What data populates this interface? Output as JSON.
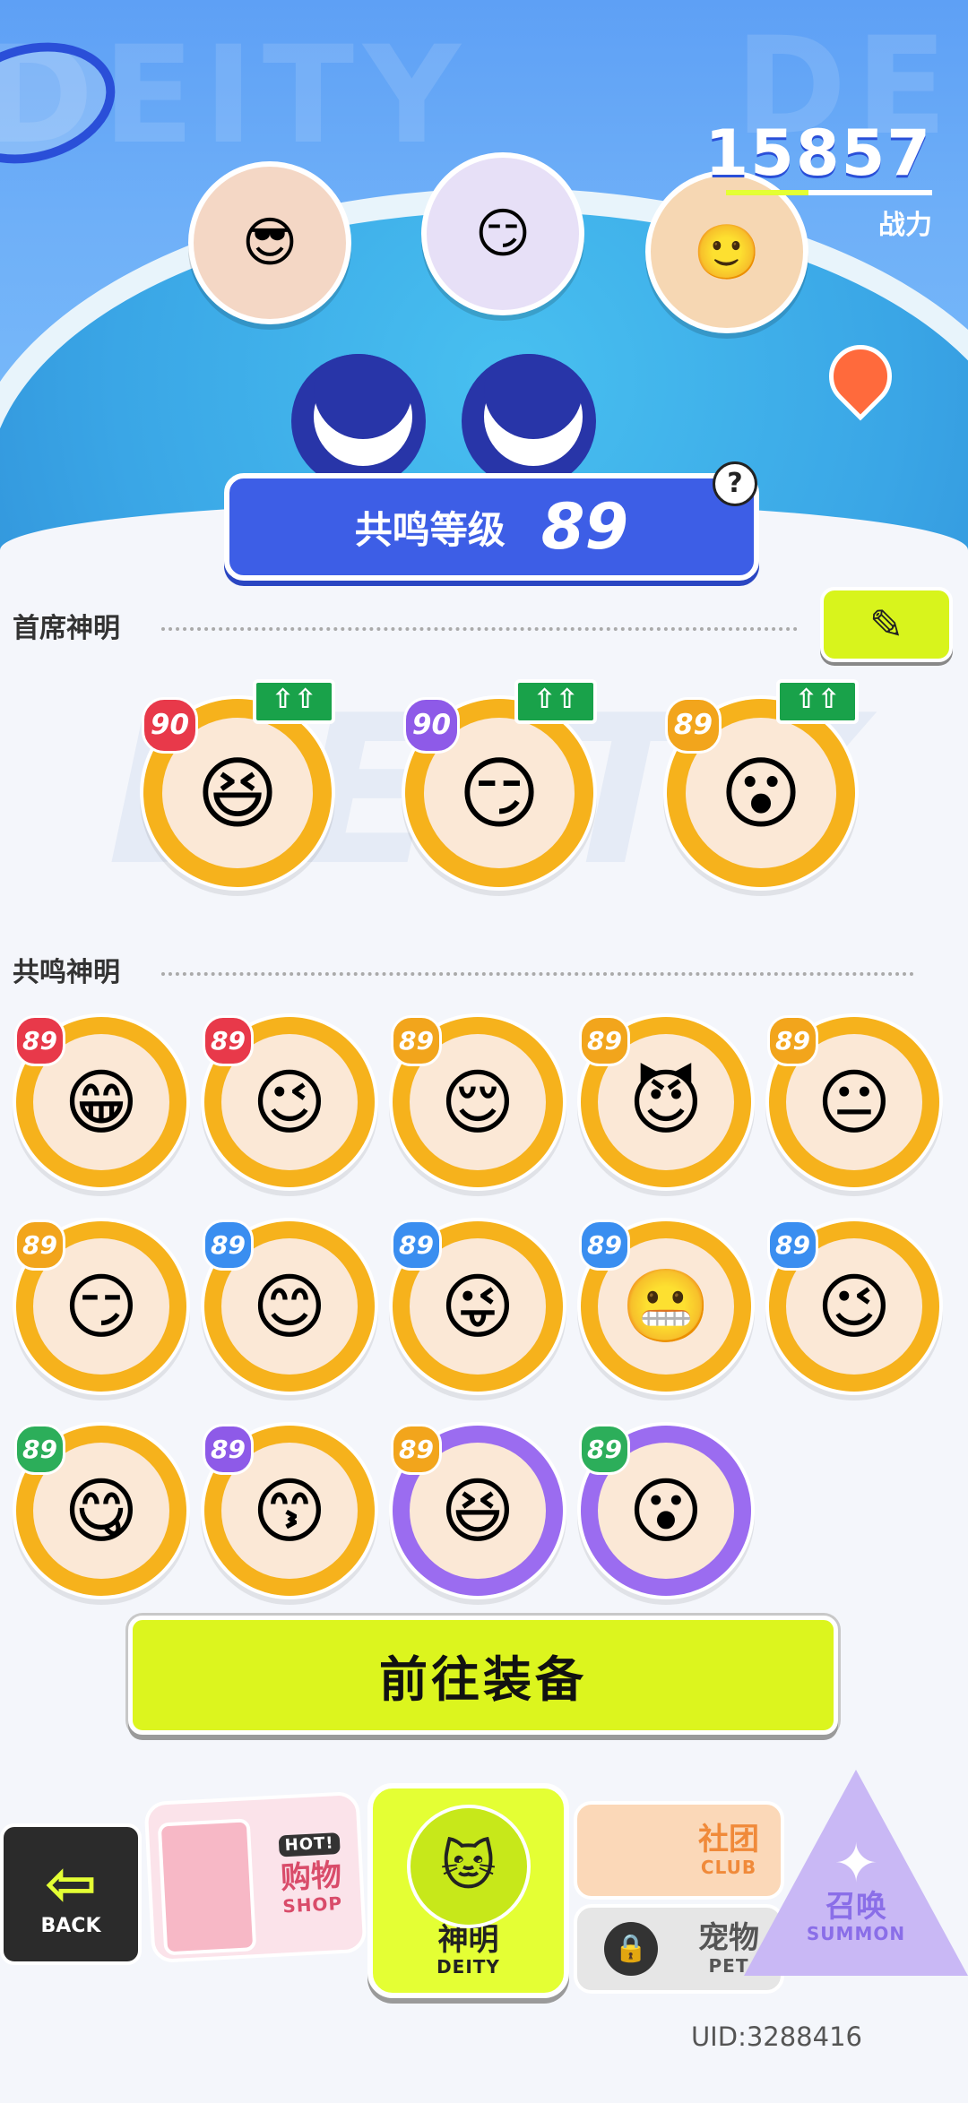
{
  "header": {
    "power_value": "15857",
    "power_label": "战力",
    "resonance_label": "共鸣等级",
    "resonance_level": "89",
    "help_icon": "?",
    "bg_word": "DEITY"
  },
  "chief": {
    "title": "首席神明",
    "edit_icon": "pencil-icon",
    "members": [
      {
        "level": "90",
        "upgrade": "⇧⇧",
        "tier": "gold",
        "badge": "red",
        "face": "😆"
      },
      {
        "level": "90",
        "upgrade": "⇧⇧",
        "tier": "gold",
        "badge": "purple",
        "face": "😏"
      },
      {
        "level": "89",
        "upgrade": "⇧⇧",
        "tier": "gold",
        "badge": "gold",
        "face": "😮"
      }
    ]
  },
  "resonance": {
    "title": "共鸣神明",
    "members": [
      {
        "level": "89",
        "tier": "gold",
        "badge": "red",
        "face": "😁"
      },
      {
        "level": "89",
        "tier": "gold",
        "badge": "red",
        "face": "😉"
      },
      {
        "level": "89",
        "tier": "gold",
        "badge": "gold",
        "face": "😌"
      },
      {
        "level": "89",
        "tier": "gold",
        "badge": "gold",
        "face": "😈"
      },
      {
        "level": "89",
        "tier": "gold",
        "badge": "gold",
        "face": "😐"
      },
      {
        "level": "89",
        "tier": "gold",
        "badge": "gold",
        "face": "😏"
      },
      {
        "level": "89",
        "tier": "gold",
        "badge": "blue",
        "face": "😊"
      },
      {
        "level": "89",
        "tier": "gold",
        "badge": "blue",
        "face": "😜"
      },
      {
        "level": "89",
        "tier": "gold",
        "badge": "blue",
        "face": "😬"
      },
      {
        "level": "89",
        "tier": "gold",
        "badge": "blue",
        "face": "😉"
      },
      {
        "level": "89",
        "tier": "gold",
        "badge": "green",
        "face": "😋"
      },
      {
        "level": "89",
        "tier": "gold",
        "badge": "purple",
        "face": "😙"
      },
      {
        "level": "89",
        "tier": "purple",
        "badge": "gold",
        "face": "😆"
      },
      {
        "level": "89",
        "tier": "purple",
        "badge": "green",
        "face": "😮"
      }
    ]
  },
  "equip_button": "前往装备",
  "nav": {
    "back": "BACK",
    "shop_cn": "购物",
    "shop_en": "SHOP",
    "shop_tag": "HOT!",
    "deity_cn": "神明",
    "deity_en": "DEITY",
    "club_cn": "社团",
    "club_en": "CLUB",
    "pet_cn": "宠物",
    "pet_en": "PET",
    "summon_cn": "召唤",
    "summon_en": "SUMMON"
  },
  "uid": "UID:3288416",
  "colors": {
    "gold_ring": "#f6b21c",
    "purple_ring": "#9b6cf0",
    "accent_lime": "#e4ff34",
    "badge_red": "#e8394a",
    "badge_purple": "#8e5ae8",
    "badge_gold": "#f2a51c",
    "badge_blue": "#3a8ef0",
    "badge_green": "#2cae5a"
  }
}
